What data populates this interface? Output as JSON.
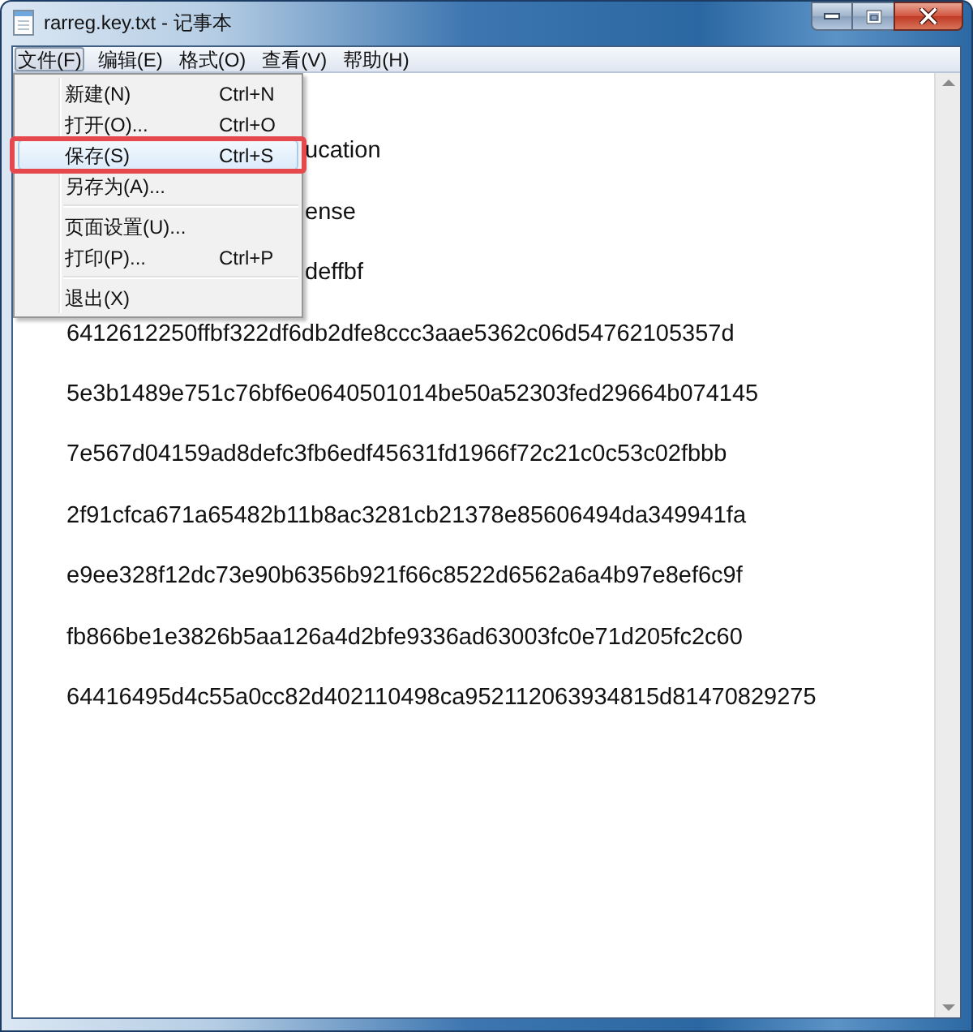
{
  "window": {
    "title": "rarreg.key.txt - 记事本",
    "buttons": [
      {
        "kind": "minimize"
      },
      {
        "kind": "maximize"
      },
      {
        "kind": "close"
      }
    ]
  },
  "menu_bar": [
    {
      "label": "文件(F)",
      "selected": true
    },
    {
      "label": "编辑(E)",
      "selected": false
    },
    {
      "label": "格式(O)",
      "selected": false
    },
    {
      "label": "查看(V)",
      "selected": false
    },
    {
      "label": "帮助(H)",
      "selected": false
    }
  ],
  "file_menu": {
    "items": [
      {
        "kind": "command",
        "label": "新建(N)",
        "shortcut": "Ctrl+N",
        "selected": false,
        "outlined": false
      },
      {
        "kind": "command",
        "label": "打开(O)...",
        "shortcut": "Ctrl+O",
        "selected": false,
        "outlined": false
      },
      {
        "kind": "command",
        "label": "保存(S)",
        "shortcut": "Ctrl+S",
        "selected": true,
        "outlined": true
      },
      {
        "kind": "command",
        "label": "另存为(A)...",
        "selected": false,
        "outlined": false
      },
      {
        "kind": "separator"
      },
      {
        "kind": "command",
        "label": "页面设置(U)...",
        "selected": false,
        "outlined": false
      },
      {
        "kind": "command",
        "label": "打印(P)...",
        "shortcut": "Ctrl+P",
        "selected": false,
        "outlined": false
      },
      {
        "kind": "separator"
      },
      {
        "kind": "command",
        "label": "退出(X)",
        "selected": false,
        "outlined": false
      }
    ]
  },
  "document": {
    "partially_hidden_lines": [
      "ucation",
      "ense",
      "deffbf"
    ],
    "lines": [
      "6412612250ffbf322df6db2dfe8ccc3aae5362c06d54762105357d",
      "5e3b1489e751c76bf6e0640501014be50a52303fed29664b074145",
      "7e567d04159ad8defc3fb6edf45631fd1966f72c21c0c53c02fbbb",
      "2f91cfca671a65482b11b8ac3281cb21378e85606494da349941fa",
      "e9ee328f12dc73e90b6356b921f66c8522d6562a6a4b97e8ef6c9f",
      "fb866be1e3826b5aa126a4d2bfe9336ad63003fc0e71d205fc2c60",
      "64416495d4c55a0cc82d402110498ca952112063934815d81470829275"
    ]
  }
}
